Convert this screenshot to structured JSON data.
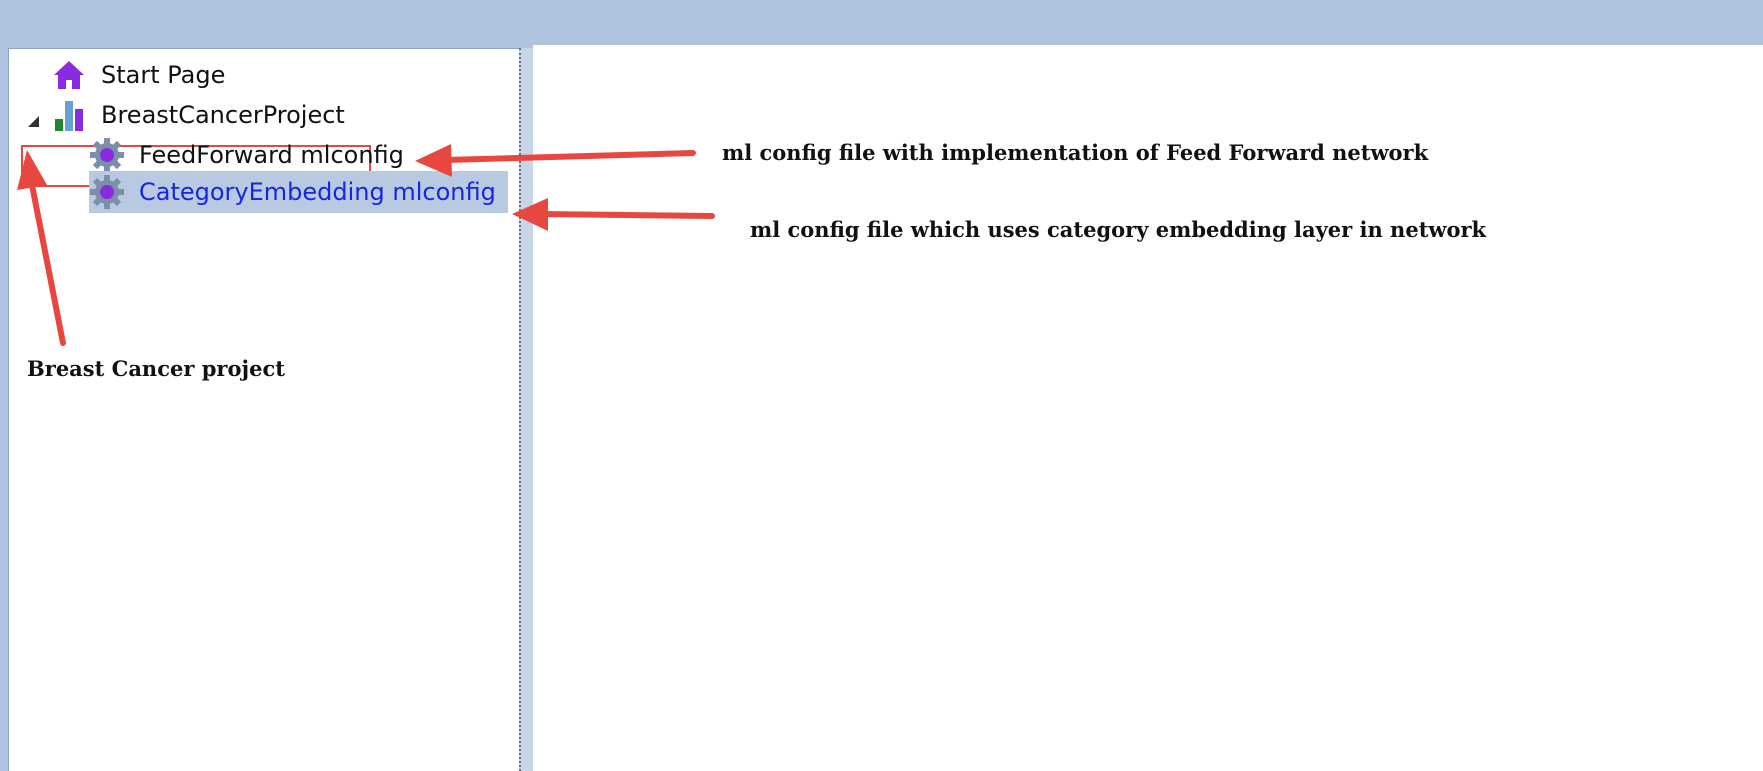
{
  "explorer": {
    "items": [
      {
        "label": "Start Page",
        "icon": "home-icon"
      },
      {
        "label": "BreastCancerProject",
        "icon": "bar-chart-icon"
      },
      {
        "label": "FeedForward mlconfig",
        "icon": "gear-icon"
      },
      {
        "label": "CategoryEmbedding mlconfig",
        "icon": "gear-icon",
        "selected": true
      }
    ]
  },
  "annotations": {
    "feedforward": "ml config file with implementation of Feed Forward network",
    "category": "ml config file which uses category embedding layer in network",
    "project": "Breast Cancer project"
  },
  "colors": {
    "titlebar": "#aec3de",
    "selection": "#b9c9e2",
    "selected_text": "#1528e0",
    "annotation_red": "#e8473f",
    "home_icon": "#8a2be2"
  }
}
